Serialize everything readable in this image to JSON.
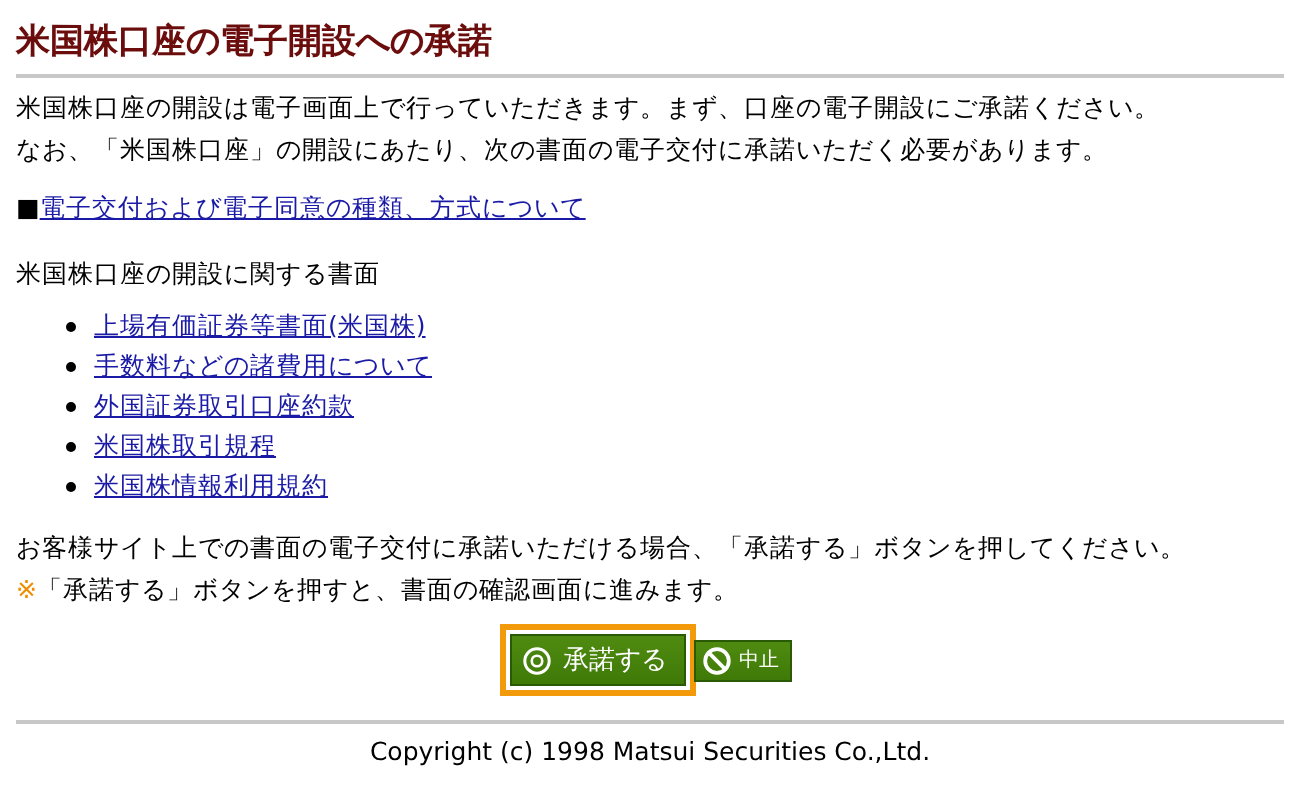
{
  "title": "米国株口座の電子開設への承諾",
  "intro": [
    "米国株口座の開設は電子画面上で行っていただきます。まず、口座の電子開設にご承諾ください。",
    "なお、「米国株口座」の開設にあたり、次の書面の電子交付に承諾いただく必要があります。"
  ],
  "info_link": {
    "marker": "■",
    "label": "電子交付および電子同意の種類、方式について"
  },
  "documents_heading": "米国株口座の開設に関する書面",
  "documents": [
    {
      "label": "上場有価証券等書面(米国株)"
    },
    {
      "label": "手数料などの諸費用について"
    },
    {
      "label": "外国証券取引口座約款"
    },
    {
      "label": "米国株取引規程"
    },
    {
      "label": "米国株情報利用規約"
    }
  ],
  "instruction": "お客様サイト上での書面の電子交付に承諾いただける場合、「承諾する」ボタンを押してください。",
  "note": {
    "mark": "※",
    "text": "「承諾する」ボタンを押すと、書面の確認画面に進みます。"
  },
  "buttons": [
    {
      "kind": "accept",
      "label": "承諾する",
      "focused": true
    },
    {
      "kind": "cancel",
      "label": "中止",
      "focused": false
    }
  ],
  "footer": "Copyright (c) 1998 Matsui Securities Co.,Ltd."
}
